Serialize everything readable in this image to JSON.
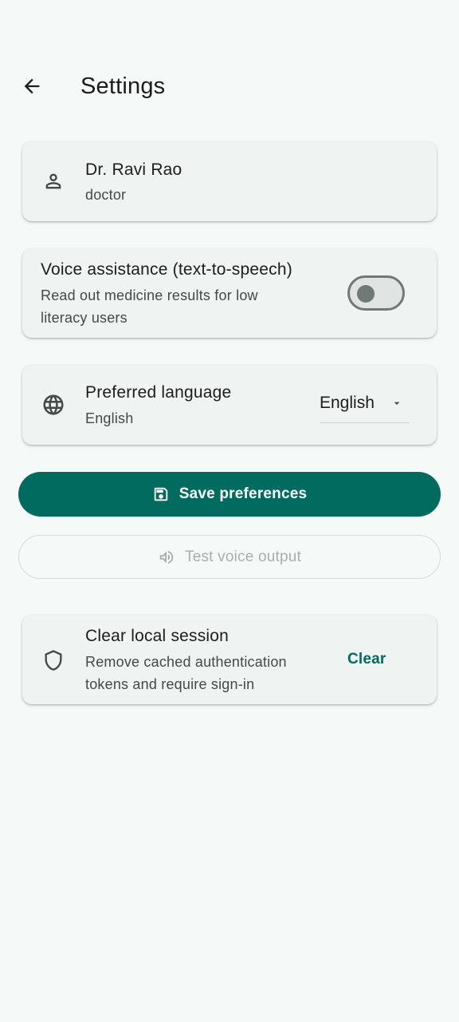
{
  "appbar": {
    "title": "Settings",
    "back_icon": "arrow-back-icon"
  },
  "profile": {
    "name": "Dr. Ravi Rao",
    "role": "doctor",
    "icon": "person-icon"
  },
  "voice": {
    "title": "Voice assistance (text-to-speech)",
    "description": "Read out medicine results for low literacy users",
    "enabled": false
  },
  "language": {
    "title": "Preferred language",
    "current": "English",
    "selected_option": "English",
    "icon": "globe-icon"
  },
  "actions": {
    "save_label": "Save preferences",
    "save_icon": "save-icon",
    "test_label": "Test voice output",
    "test_icon": "volume-icon"
  },
  "session": {
    "title": "Clear local session",
    "description": "Remove cached authentication tokens and require sign-in",
    "clear_label": "Clear",
    "icon": "shield-icon"
  },
  "colors": {
    "primary": "#006b5e",
    "background": "#f5faf8",
    "card": "#eff3f1",
    "disabled_text": "#a9aeac"
  }
}
